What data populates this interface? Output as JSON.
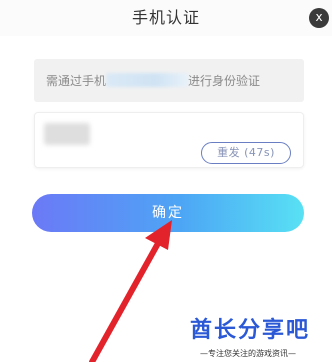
{
  "dialog": {
    "title": "手机认证",
    "close_label": "x"
  },
  "phone_notice": {
    "prefix": "需通过手机",
    "suffix": "进行身份验证"
  },
  "code_field": {
    "resend_label": "重发 (47s)"
  },
  "confirm_label": "确定",
  "watermark": {
    "brand": "酋长分享吧",
    "tagline": "—专注您关注的游戏资讯—"
  },
  "colors": {
    "arrow": "#e3232b",
    "button_gradient": [
      "#6b79f6",
      "#58e1f4"
    ],
    "resend_border": "#6a7fc3",
    "watermark": "#2b59d6"
  },
  "icons": {
    "close": "close-icon",
    "annotation_arrow": "arrow-icon"
  }
}
